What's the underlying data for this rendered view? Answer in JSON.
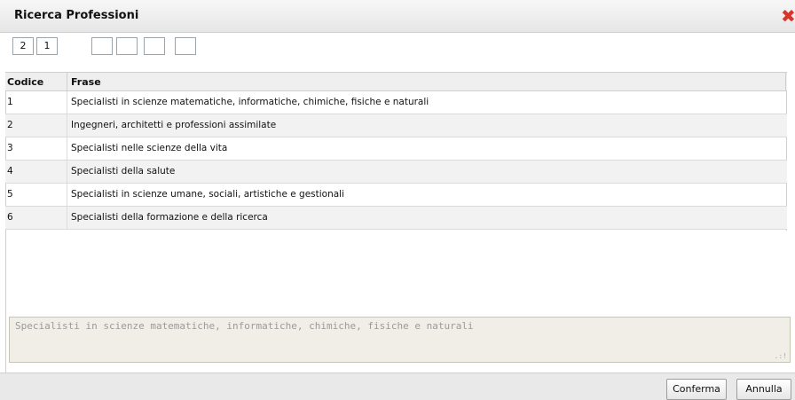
{
  "dialog": {
    "title": "Ricerca Professioni",
    "close_icon": "close-icon"
  },
  "code_boxes": [
    "2",
    "1",
    "",
    "",
    "",
    ""
  ],
  "grid": {
    "columns": [
      "Codice",
      "Frase"
    ],
    "rows": [
      {
        "code": "1",
        "phrase": "Specialisti in scienze matematiche, informatiche, chimiche, fisiche e naturali"
      },
      {
        "code": "2",
        "phrase": "Ingegneri, architetti e professioni assimilate"
      },
      {
        "code": "3",
        "phrase": "Specialisti nelle scienze della vita"
      },
      {
        "code": "4",
        "phrase": "Specialisti della salute"
      },
      {
        "code": "5",
        "phrase": "Specialisti in scienze umane, sociali, artistiche e gestionali"
      },
      {
        "code": "6",
        "phrase": "Specialisti della formazione e della ricerca"
      }
    ]
  },
  "preview_text": "Specialisti in scienze matematiche, informatiche, chimiche, fisiche e naturali",
  "buttons": {
    "confirm": "Conferma",
    "cancel": "Annulla"
  },
  "colors": {
    "close_icon": "#d9342a",
    "preview_bg": "#f0eee6"
  }
}
